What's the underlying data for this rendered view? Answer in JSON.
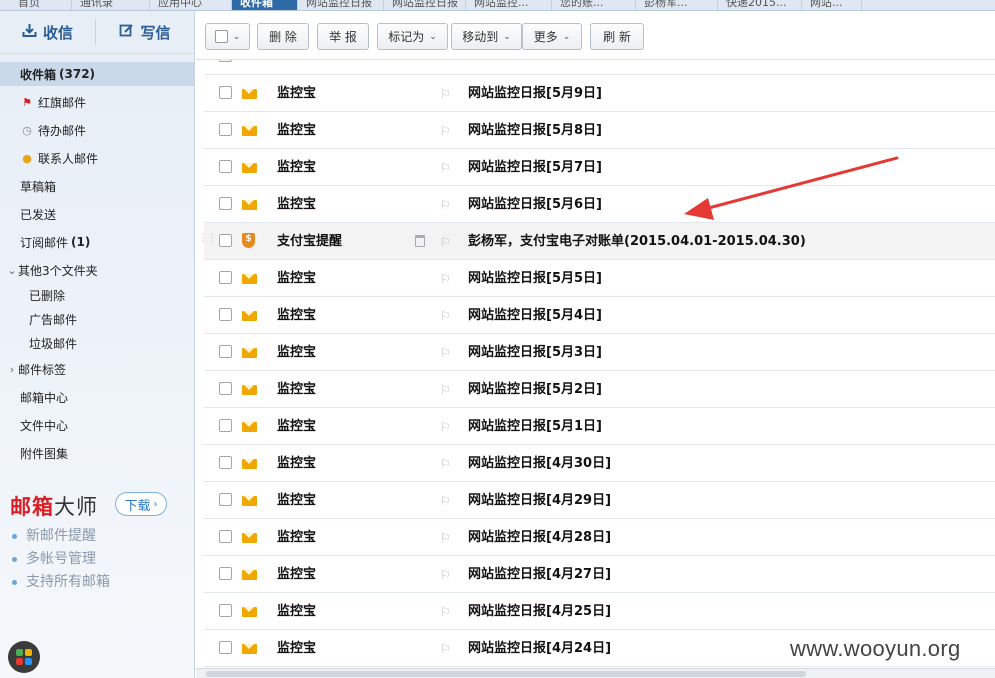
{
  "top_tabs": [
    {
      "label": "首页",
      "active": false
    },
    {
      "label": "通讯录",
      "active": false
    },
    {
      "label": "应用中心",
      "active": false
    },
    {
      "label": "收件箱",
      "active": true
    },
    {
      "label": "网站监控日报",
      "active": false
    },
    {
      "label": "网站监控日报",
      "active": false
    },
    {
      "label": "网站监控...",
      "active": false
    },
    {
      "label": "您的账...",
      "active": false
    },
    {
      "label": "彭杨军...",
      "active": false
    },
    {
      "label": "快递2015...",
      "active": false
    },
    {
      "label": "网站...",
      "active": false
    }
  ],
  "sidebar": {
    "receive_label": "收信",
    "compose_label": "写信",
    "inbox_label": "收件箱",
    "inbox_count": "(372)",
    "flagged_label": "红旗邮件",
    "todo_label": "待办邮件",
    "contacts_label": "联系人邮件",
    "drafts_label": "草稿箱",
    "sent_label": "已发送",
    "subscribe_label": "订阅邮件",
    "subscribe_count": "(1)",
    "other_folders_label": "其他3个文件夹",
    "deleted_label": "已删除",
    "ads_label": "广告邮件",
    "spam_label": "垃圾邮件",
    "tags_label": "邮件标签",
    "mail_center_label": "邮箱中心",
    "file_center_label": "文件中心",
    "attachments_label": "附件图集"
  },
  "promo": {
    "logo_red": "邮箱",
    "logo_dark": "大师",
    "download_label": "下载",
    "features": [
      "新邮件提醒",
      "多帐号管理",
      "支持所有邮箱"
    ]
  },
  "toolbar": {
    "delete_label": "删 除",
    "report_label": "举 报",
    "markas_label": "标记为",
    "moveto_label": "移动到",
    "more_label": "更多",
    "refresh_label": "刷 新"
  },
  "emails": [
    {
      "sender": "监控宝",
      "subject": "网站监控日报[5月9日]",
      "type": "mail"
    },
    {
      "sender": "监控宝",
      "subject": "网站监控日报[5月8日]",
      "type": "mail"
    },
    {
      "sender": "监控宝",
      "subject": "网站监控日报[5月7日]",
      "type": "mail"
    },
    {
      "sender": "监控宝",
      "subject": "网站监控日报[5月6日]",
      "type": "mail"
    },
    {
      "sender": "支付宝提醒",
      "subject": "彭杨军，支付宝电子对账单(2015.04.01-2015.04.30)",
      "type": "alipay"
    },
    {
      "sender": "监控宝",
      "subject": "网站监控日报[5月5日]",
      "type": "mail"
    },
    {
      "sender": "监控宝",
      "subject": "网站监控日报[5月4日]",
      "type": "mail"
    },
    {
      "sender": "监控宝",
      "subject": "网站监控日报[5月3日]",
      "type": "mail"
    },
    {
      "sender": "监控宝",
      "subject": "网站监控日报[5月2日]",
      "type": "mail"
    },
    {
      "sender": "监控宝",
      "subject": "网站监控日报[5月1日]",
      "type": "mail"
    },
    {
      "sender": "监控宝",
      "subject": "网站监控日报[4月30日]",
      "type": "mail"
    },
    {
      "sender": "监控宝",
      "subject": "网站监控日报[4月29日]",
      "type": "mail"
    },
    {
      "sender": "监控宝",
      "subject": "网站监控日报[4月28日]",
      "type": "mail"
    },
    {
      "sender": "监控宝",
      "subject": "网站监控日报[4月27日]",
      "type": "mail"
    },
    {
      "sender": "监控宝",
      "subject": "网站监控日报[4月25日]",
      "type": "mail"
    },
    {
      "sender": "监控宝",
      "subject": "网站监控日报[4月24日]",
      "type": "mail"
    }
  ],
  "watermark": "www.wooyun.org",
  "colors": {
    "accent": "#2e6aa6",
    "envelope": "#f0a800",
    "alipay": "#e58a1e",
    "annotation_arrow": "#e53935"
  }
}
